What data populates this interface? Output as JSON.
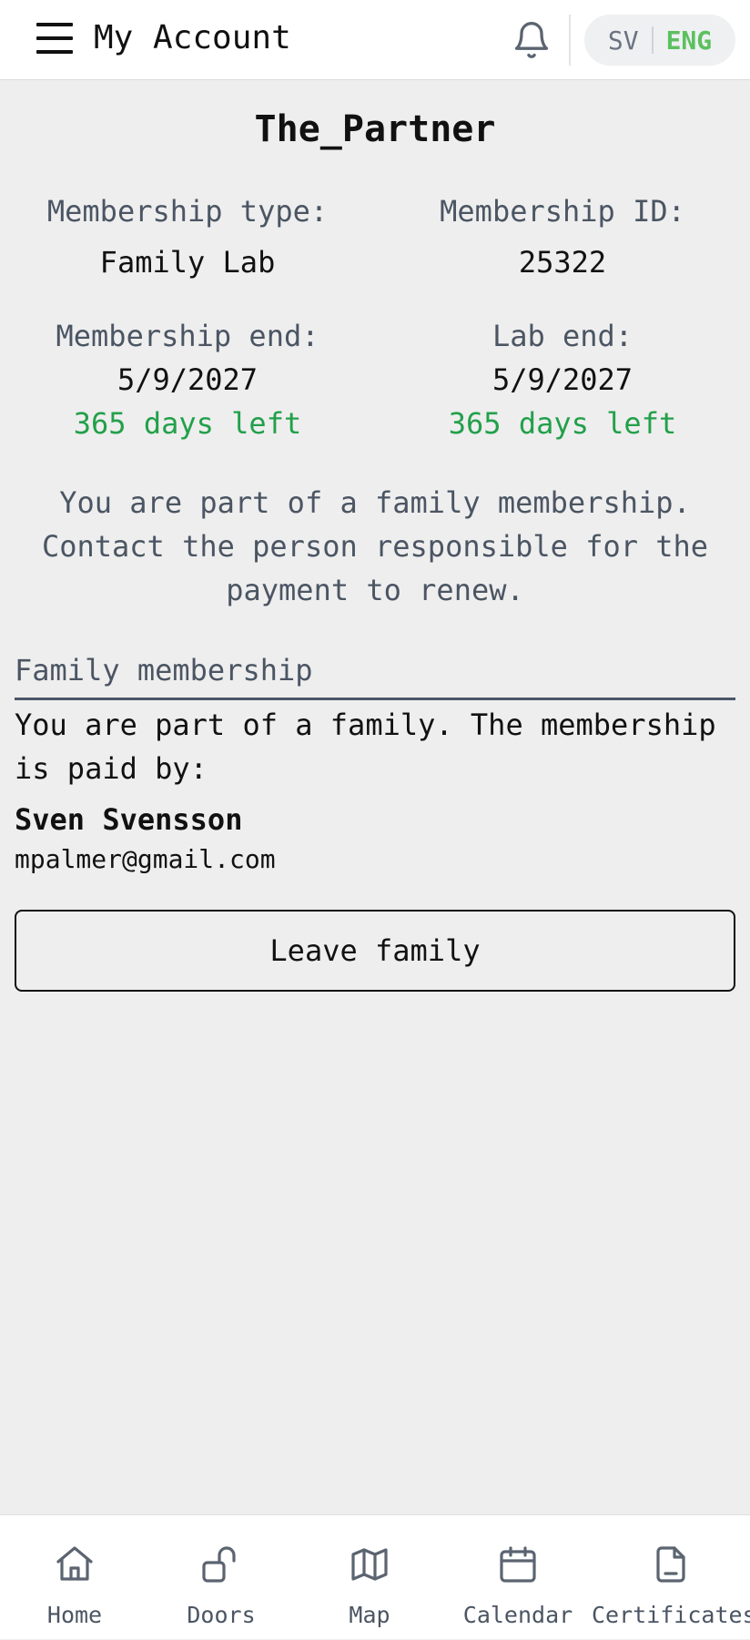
{
  "header": {
    "title": "My Account",
    "menu_icon": "hamburger-menu-icon",
    "notification_icon": "bell-icon",
    "languages": {
      "sv": "SV",
      "eng": "ENG",
      "active": "ENG"
    }
  },
  "profile": {
    "username": "The_Partner",
    "membership_type_label": "Membership type:",
    "membership_type_value": "Family Lab",
    "membership_id_label": "Membership ID:",
    "membership_id_value": "25322",
    "membership_end_label": "Membership end:",
    "membership_end_value": "5/9/2027",
    "membership_end_days": "365 days left",
    "lab_end_label": "Lab end:",
    "lab_end_value": "5/9/2027",
    "lab_end_days": "365 days left",
    "note": "You are part of a family membership. Contact the person responsible for the payment to renew."
  },
  "family": {
    "section_title": "Family membership",
    "text": "You are part of a family. The membership is paid by:",
    "payer_name": "Sven Svensson",
    "payer_email": "mpalmer@gmail.com",
    "leave_button": "Leave family"
  },
  "nav": {
    "items": [
      {
        "label": "Home",
        "icon": "home-icon"
      },
      {
        "label": "Doors",
        "icon": "unlock-icon"
      },
      {
        "label": "Map",
        "icon": "map-icon"
      },
      {
        "label": "Calendar",
        "icon": "calendar-icon"
      },
      {
        "label": "Certificates",
        "icon": "document-icon"
      }
    ]
  },
  "colors": {
    "accent_green": "#22a04a",
    "active_language": "#5cc05f",
    "muted_text": "#4b5563",
    "background": "#eeeeee"
  }
}
